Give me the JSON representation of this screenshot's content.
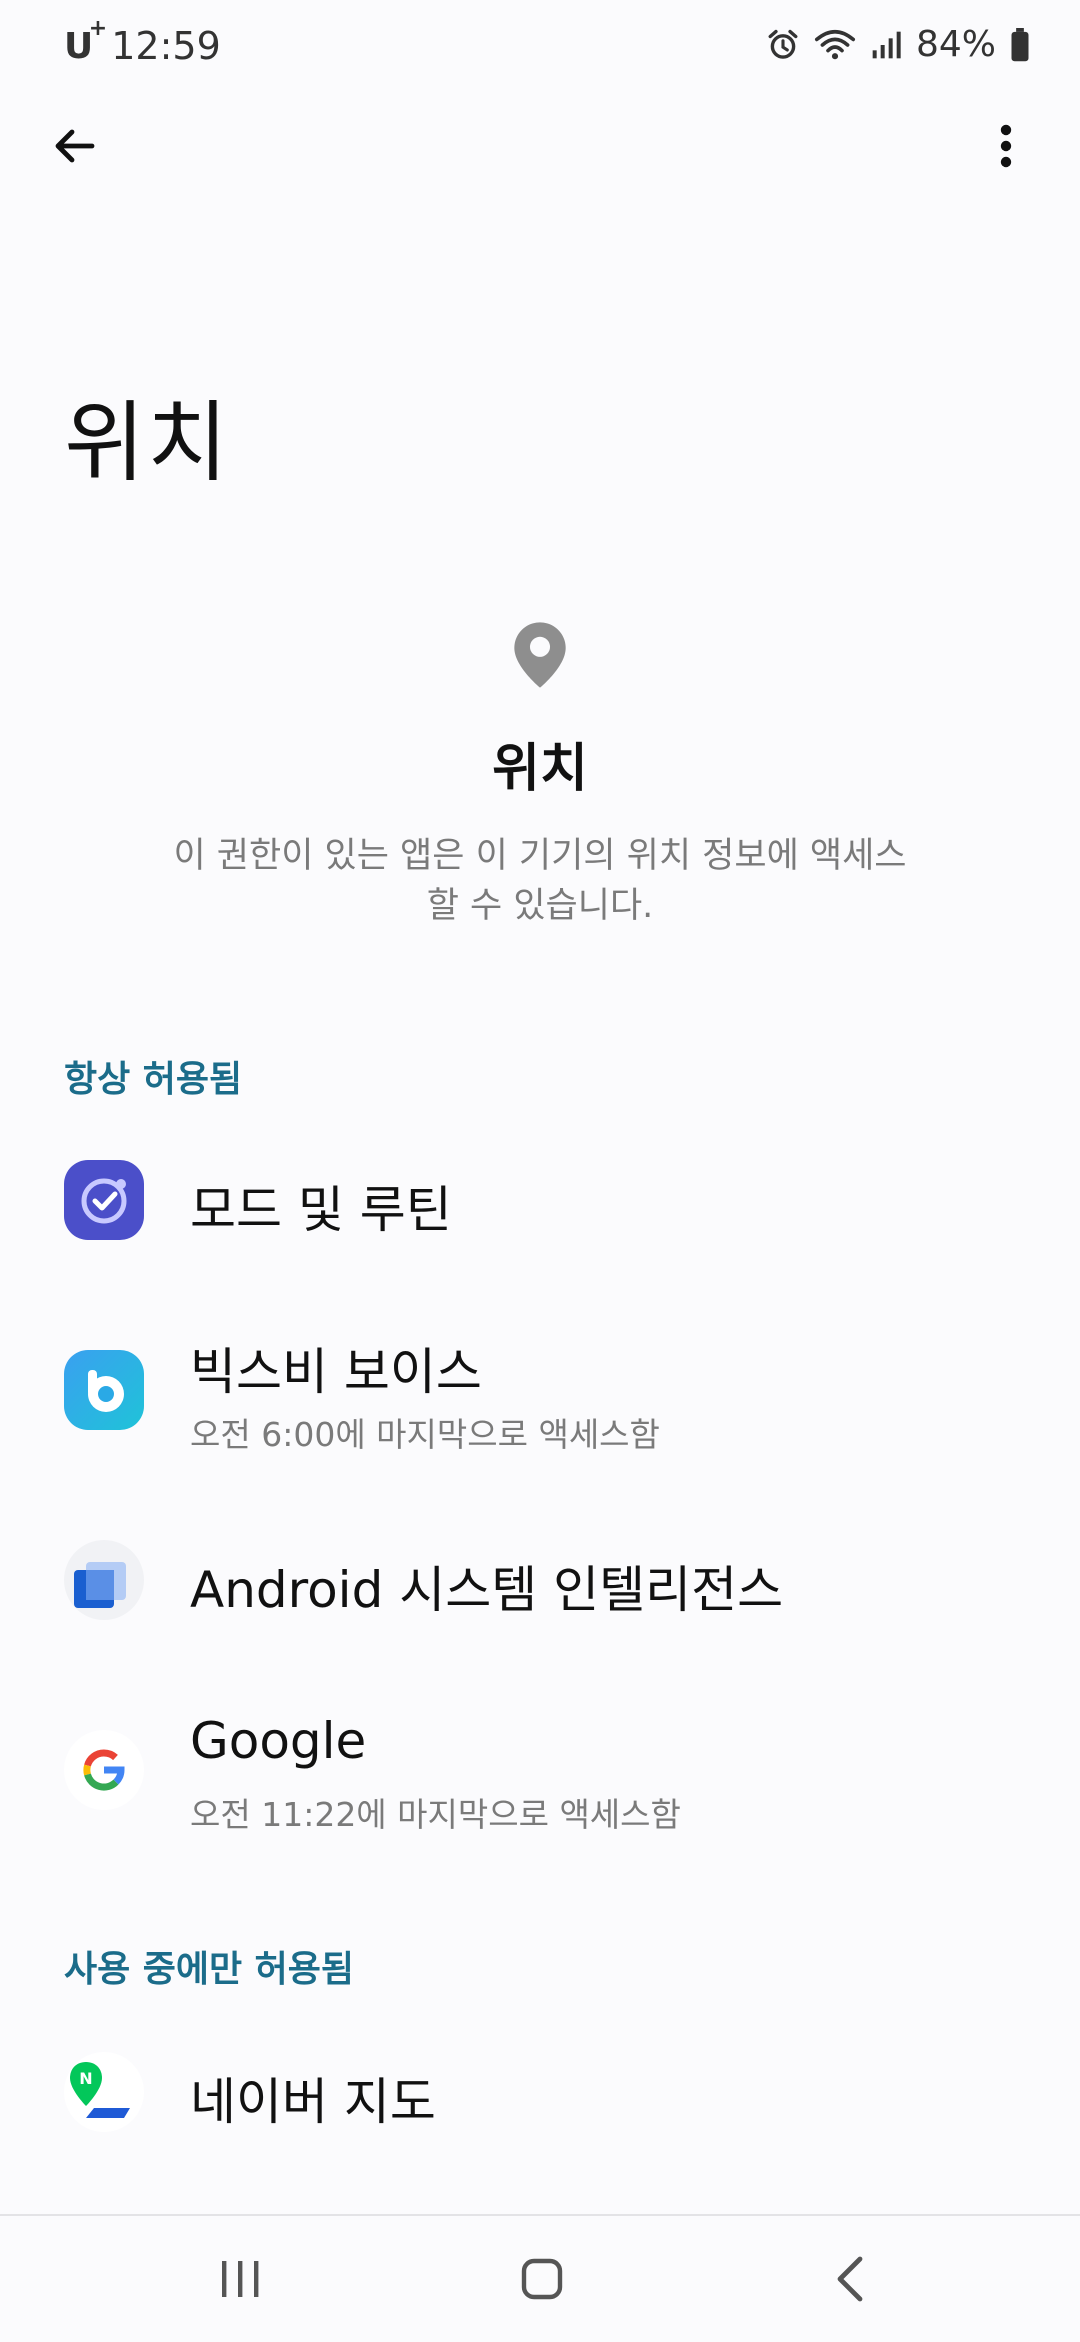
{
  "status": {
    "carrier": "U",
    "carrier_sup": "+",
    "time": "12:59",
    "battery": "84%"
  },
  "page": {
    "title": "위치"
  },
  "hero": {
    "icon": "location-pin-icon",
    "title": "위치",
    "description": "이 권한이 있는 앱은 이 기기의 위치 정보에 액세스할 수 있습니다."
  },
  "sections": {
    "always": {
      "header": "항상 허용됨",
      "apps": [
        {
          "name": "모드 및 루틴",
          "icon": "modes-routines-icon"
        },
        {
          "name": "빅스비 보이스",
          "sub": "오전 6:00에 마지막으로 액세스함",
          "icon": "bixby-icon"
        },
        {
          "name": "Android 시스템 인텔리전스",
          "icon": "android-system-intelligence-icon"
        },
        {
          "name": "Google",
          "sub": "오전 11:22에 마지막으로 액세스함",
          "icon": "google-icon"
        }
      ]
    },
    "while_in_use": {
      "header": "사용 중에만 허용됨",
      "apps": [
        {
          "name": "네이버 지도",
          "icon": "naver-map-icon"
        }
      ]
    }
  },
  "colors": {
    "accent": "#1b6c8a",
    "background": "#fbfbfd"
  }
}
